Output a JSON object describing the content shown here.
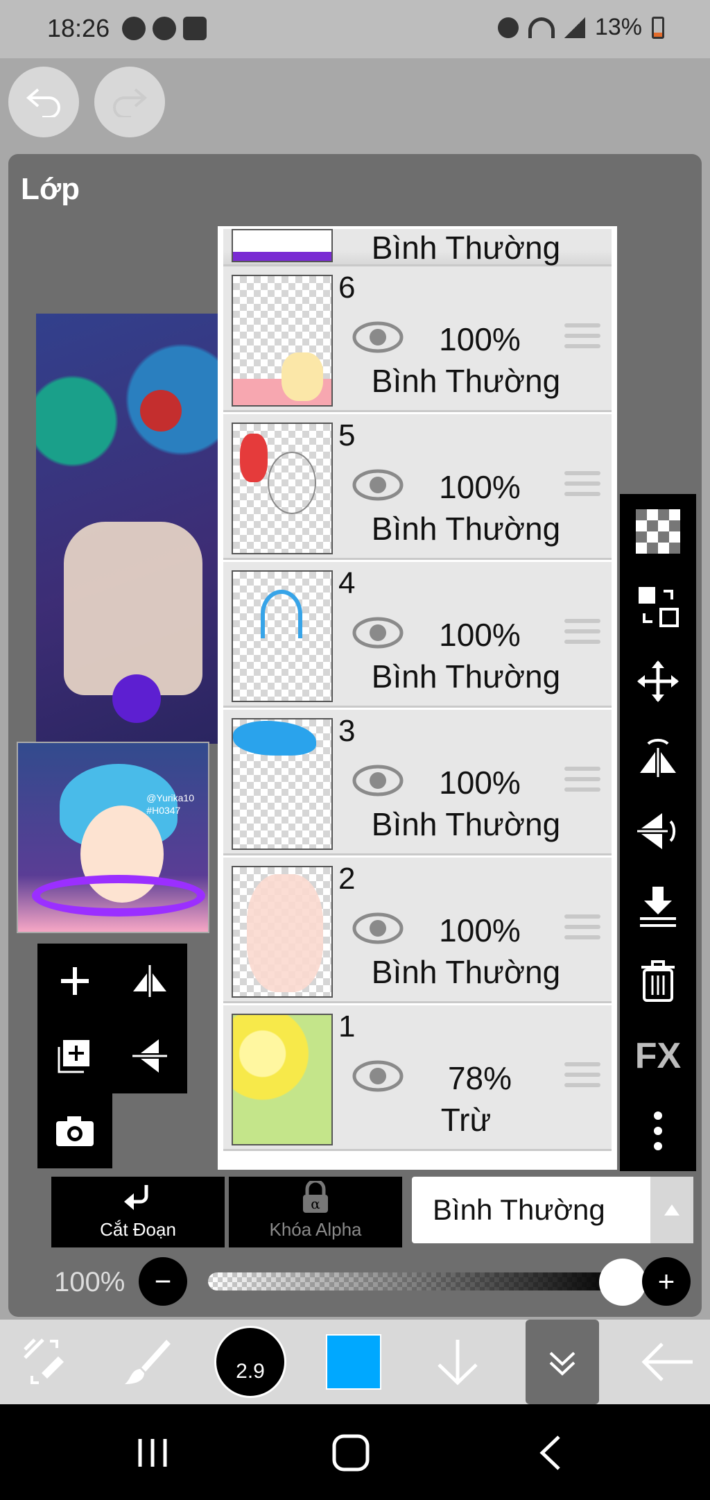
{
  "status_bar": {
    "time": "18:26",
    "battery": "13%",
    "left_icons": [
      "messenger-icon",
      "messenger-icon",
      "screenshot-icon"
    ],
    "right_icons": [
      "alarm-icon",
      "wifi-icon",
      "signal-icon",
      "battery-icon"
    ]
  },
  "panel": {
    "title": "Lớp"
  },
  "layers": [
    {
      "number": "",
      "opacity": "",
      "mode": "Bình Thường",
      "partial": true
    },
    {
      "number": "6",
      "opacity": "100%",
      "mode": "Bình Thường"
    },
    {
      "number": "5",
      "opacity": "100%",
      "mode": "Bình Thường"
    },
    {
      "number": "4",
      "opacity": "100%",
      "mode": "Bình Thường"
    },
    {
      "number": "3",
      "opacity": "100%",
      "mode": "Bình Thường"
    },
    {
      "number": "2",
      "opacity": "100%",
      "mode": "Bình Thường"
    },
    {
      "number": "1",
      "opacity": "78%",
      "mode": "Trừ"
    }
  ],
  "thumbnail": {
    "tag_line1": "@Yurika10",
    "tag_line2": "#H0347"
  },
  "buttons": {
    "clipping": "Cắt Đoạn",
    "alpha_lock": "Khóa Alpha"
  },
  "blend_mode": {
    "selected": "Bình Thường"
  },
  "opacity": {
    "label": "100%",
    "minus": "−",
    "plus": "+",
    "value": 1.0
  },
  "toolbar": {
    "brush_size": "2.9",
    "color": "#00a8ff"
  },
  "colors": {
    "panel": "#6e6e6e",
    "accent": "#00a8ff",
    "layer_bg": "#e7e7e7"
  }
}
